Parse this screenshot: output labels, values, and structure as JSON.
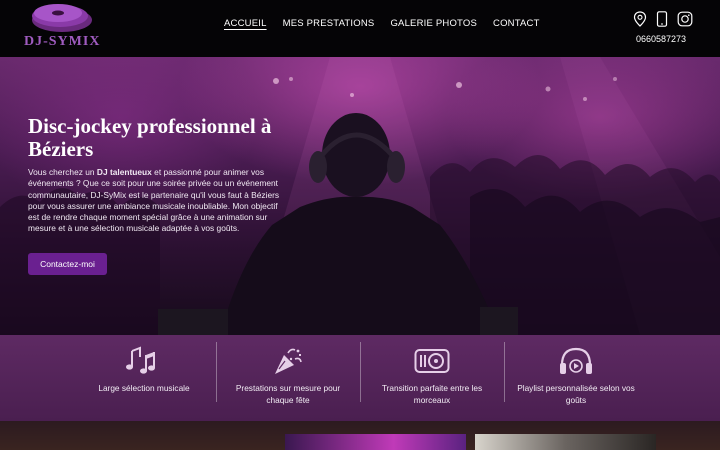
{
  "brand": {
    "name": "DJ-SYMIX",
    "logo_icon": "vinyl-discs-logo"
  },
  "nav": {
    "items": [
      {
        "label": "ACCUEIL",
        "active": true
      },
      {
        "label": "MES PRESTATIONS",
        "active": false
      },
      {
        "label": "GALERIE PHOTOS",
        "active": false
      },
      {
        "label": "CONTACT",
        "active": false
      }
    ]
  },
  "contact": {
    "icons": [
      "map-pin-icon",
      "phone-icon",
      "instagram-icon"
    ],
    "phone": "0660587273"
  },
  "hero": {
    "title": "Disc-jockey professionnel à Béziers",
    "text_before": "Vous cherchez un ",
    "text_bold": "DJ talentueux",
    "text_after": " et passionné pour animer vos événements ? Que ce soit pour une soirée privée ou un événement communautaire, DJ-SyMix est le partenaire qu'il vous faut à Béziers pour vous assurer une ambiance musicale inoubliable. Mon objectif est de rendre chaque moment spécial grâce à une animation sur mesure et à une sélection musicale adaptée à vos goûts.",
    "cta_label": "Contactez-moi"
  },
  "features": [
    {
      "icon": "music-notes-icon",
      "label": "Large sélection musicale"
    },
    {
      "icon": "party-popper-icon",
      "label": "Prestations sur mesure pour chaque fête"
    },
    {
      "icon": "dj-deck-icon",
      "label": "Transition parfaite entre les morceaux"
    },
    {
      "icon": "headphones-play-icon",
      "label": "Playlist personnalisée selon vos goûts"
    }
  ],
  "colors": {
    "accent": "#6a2090",
    "feature_bg": "#5e2a63",
    "header_bg": "#050406"
  }
}
